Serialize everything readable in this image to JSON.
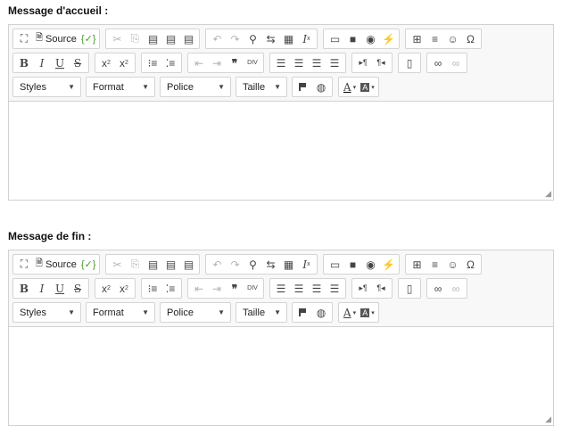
{
  "editors": [
    {
      "label": "Message d'accueil :",
      "toolbar": {
        "source_label": "Source",
        "styles_label": "Styles",
        "format_label": "Format",
        "font_label": "Police",
        "size_label": "Taille"
      }
    },
    {
      "label": "Message de fin :",
      "toolbar": {
        "source_label": "Source",
        "styles_label": "Styles",
        "format_label": "Format",
        "font_label": "Police",
        "size_label": "Taille"
      }
    }
  ],
  "icons": {
    "maximize": "⛶",
    "source_doc": "🗎",
    "templates": "{✓}",
    "cut": "✂",
    "copy": "⎘",
    "paste": "📋",
    "paste_text": "📋",
    "paste_word": "📋",
    "undo": "↶",
    "redo": "↷",
    "find": "🔍",
    "replace": "↹",
    "select_all": "▦",
    "remove_format": "Ix",
    "image": "▭",
    "flash": "■",
    "video": "◉",
    "iframe": "⚡",
    "table": "⊞",
    "hr": "≡",
    "smiley": "☺",
    "special_char": "Ω",
    "bold": "B",
    "italic": "I",
    "underline": "U",
    "strike": "S",
    "subscript": "x",
    "superscript": "x",
    "ol": "⒈",
    "ul": "☰",
    "outdent": "⇤",
    "indent": "⇥",
    "blockquote": "❞",
    "div": "DIV",
    "align_left": "☰",
    "align_center": "☰",
    "align_right": "☰",
    "justify": "☰",
    "ltr": "¶",
    "rtl": "¶",
    "show_blocks": "▯",
    "link": "∞",
    "unlink": "∞",
    "anchor": "⚑",
    "language": "🌐",
    "text_color": "A",
    "bg_color": "A"
  }
}
